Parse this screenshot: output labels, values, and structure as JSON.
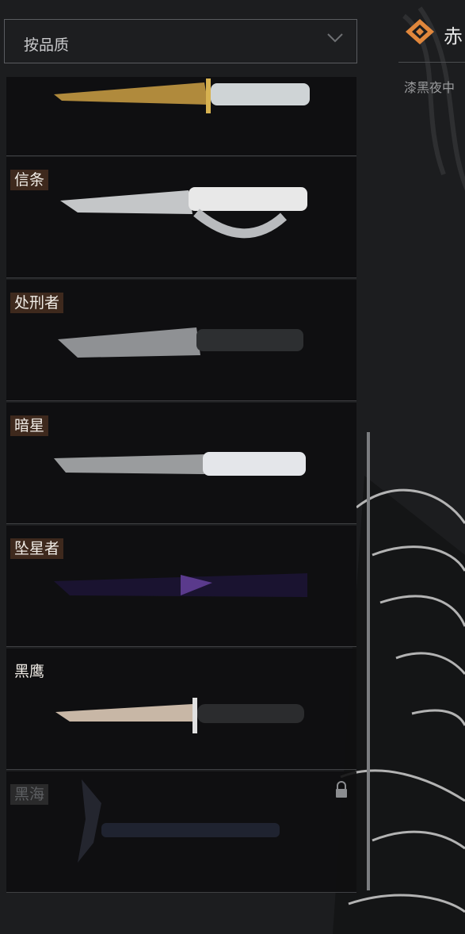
{
  "filter": {
    "label": "按品质"
  },
  "detail": {
    "title": "赤",
    "subtitle": "漆黑夜中"
  },
  "knives": [
    {
      "name": "",
      "locked": false
    },
    {
      "name": "信条",
      "locked": false
    },
    {
      "name": "处刑者",
      "locked": false
    },
    {
      "name": "暗星",
      "locked": false
    },
    {
      "name": "坠星者",
      "locked": false
    },
    {
      "name": "黑鹰",
      "locked": false
    },
    {
      "name": "黑海",
      "locked": true
    }
  ]
}
